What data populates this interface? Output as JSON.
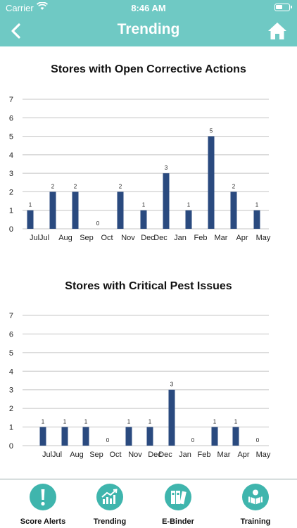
{
  "status": {
    "carrier": "Carrier",
    "time": "8:46 AM"
  },
  "nav": {
    "title": "Trending"
  },
  "charts": [
    {
      "title": "Stores with Open Corrective Actions",
      "chart_data": {
        "type": "bar",
        "categories": [
          "Jul",
          "Jul",
          "Aug",
          "Sep",
          "Oct",
          "Nov",
          "Dec",
          "Dec",
          "Jan",
          "Feb",
          "Mar",
          "Apr",
          "May"
        ],
        "values": [
          1,
          2,
          2,
          0,
          2,
          1,
          3,
          1,
          5,
          2,
          1
        ],
        "ylim": [
          0,
          7
        ],
        "yticks": [
          0,
          1,
          2,
          3,
          4,
          5,
          6,
          7
        ],
        "bar_color": "#2a4a7f",
        "grid": true
      }
    },
    {
      "title": "Stores with Critical Pest Issues",
      "chart_data": {
        "type": "bar",
        "categories": [
          "Jul",
          "Jul",
          "Aug",
          "Sep",
          "Oct",
          "Nov",
          "Dec",
          "Dec",
          "Jan",
          "Feb",
          "Mar",
          "Apr",
          "May"
        ],
        "values": [
          1,
          1,
          1,
          0,
          1,
          1,
          3,
          0,
          1,
          1,
          0
        ],
        "ylim": [
          0,
          7
        ],
        "yticks": [
          0,
          1,
          2,
          3,
          4,
          5,
          6,
          7
        ],
        "bar_color": "#2a4a7f",
        "grid": true
      }
    }
  ],
  "tabs": [
    {
      "label": "Score Alerts",
      "icon": "exclamation-icon"
    },
    {
      "label": "Trending",
      "icon": "chart-icon"
    },
    {
      "label": "E-Binder",
      "icon": "binder-icon"
    },
    {
      "label": "Training",
      "icon": "training-icon"
    }
  ],
  "colors": {
    "accent": "#6fc9c4",
    "tab_icon": "#3fb5ad"
  }
}
